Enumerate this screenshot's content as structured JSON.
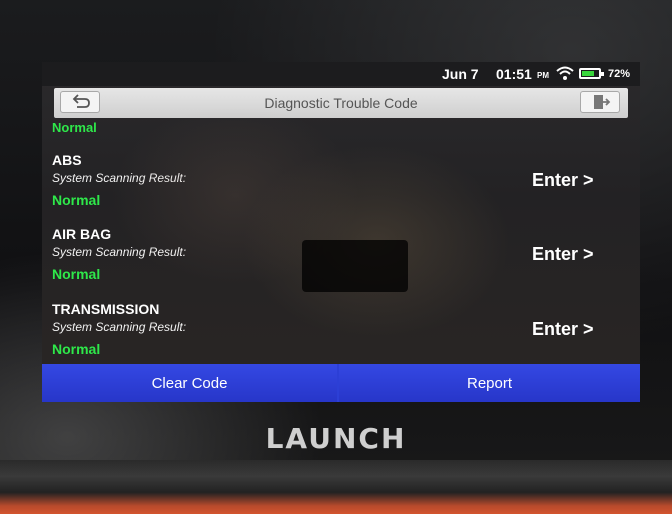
{
  "device": {
    "brand": "LAUNCH"
  },
  "statusbar": {
    "date": "Jun 7",
    "time": "01:51",
    "ampm": "PM",
    "battery_percent": "72%",
    "battery_level": 0.72,
    "wifi_icon": "wifi-icon"
  },
  "titlebar": {
    "title": "Diagnostic Trouble Code",
    "back_icon": "back-arrow-icon",
    "exit_icon": "exit-door-icon"
  },
  "list": {
    "top_status": "Normal",
    "items": [
      {
        "name": "ABS",
        "subtitle": "System Scanning Result:",
        "result": "Normal",
        "action": "Enter >"
      },
      {
        "name": "AIR BAG",
        "subtitle": "System Scanning Result:",
        "result": "Normal",
        "action": "Enter >"
      },
      {
        "name": "TRANSMISSION",
        "subtitle": "System Scanning Result:",
        "result": "Normal",
        "action": "Enter >"
      }
    ]
  },
  "bottombar": {
    "clear_label": "Clear Code",
    "report_label": "Report"
  },
  "colors": {
    "accent": "#2c3fd6",
    "normal": "#2ee84a",
    "bezel_accent": "#d3542e"
  }
}
